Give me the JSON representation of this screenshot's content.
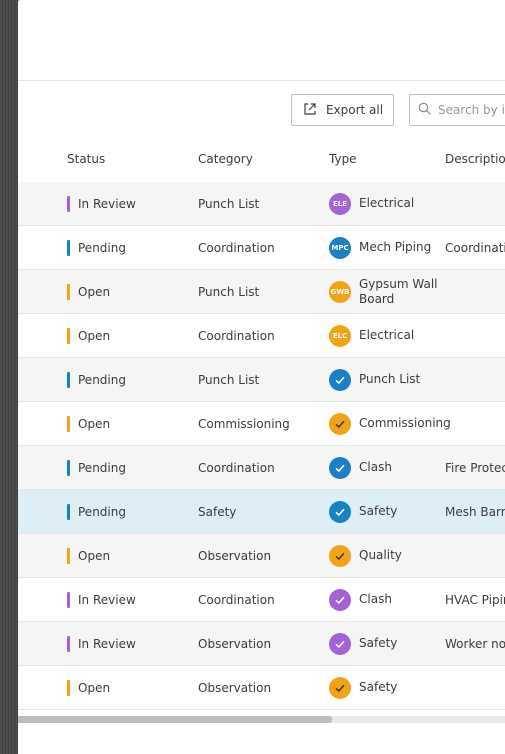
{
  "colors": {
    "in_review": "#a463d7",
    "pending": "#1b80c4",
    "open": "#f2a31a",
    "selected_row": "#ddeef6"
  },
  "toolbar": {
    "export_label": "Export all",
    "export_icon": "export-icon",
    "search_placeholder": "Search by issue",
    "search_icon": "search-icon"
  },
  "table": {
    "headers": {
      "status": "Status",
      "category": "Category",
      "type": "Type",
      "description": "Description"
    },
    "rows": [
      {
        "status": "In Review",
        "status_key": "in_review",
        "category": "Punch List",
        "type": "Electrical",
        "badge": "ELE",
        "badge_color": "#a463d7",
        "description": ""
      },
      {
        "status": "Pending",
        "status_key": "pending",
        "category": "Coordination",
        "type": "Mech Piping",
        "badge": "MPC",
        "badge_color": "#1b80c4",
        "description": "Coordination"
      },
      {
        "status": "Open",
        "status_key": "open",
        "category": "Punch List",
        "type": "Gypsum Wall Board",
        "badge": "GWB",
        "badge_color": "#f2a31a",
        "description": ""
      },
      {
        "status": "Open",
        "status_key": "open",
        "category": "Coordination",
        "type": "Electrical",
        "badge": "ELC",
        "badge_color": "#f2a31a",
        "description": ""
      },
      {
        "status": "Pending",
        "status_key": "pending",
        "category": "Punch List",
        "type": "Punch List",
        "badge": "check-icon",
        "badge_color": "#1b80c4",
        "description": ""
      },
      {
        "status": "Open",
        "status_key": "open",
        "category": "Commissioning",
        "type": "Commissioning",
        "badge": "check-icon",
        "badge_color": "#f2a31a",
        "description": ""
      },
      {
        "status": "Pending",
        "status_key": "pending",
        "category": "Coordination",
        "type": "Clash",
        "badge": "check-icon",
        "badge_color": "#1b80c4",
        "description": "Fire Protection"
      },
      {
        "status": "Pending",
        "status_key": "pending",
        "category": "Safety",
        "type": "Safety",
        "badge": "check-icon",
        "badge_color": "#1b80c4",
        "description": "Mesh Barrier",
        "selected": true
      },
      {
        "status": "Open",
        "status_key": "open",
        "category": "Observation",
        "type": "Quality",
        "badge": "check-icon",
        "badge_color": "#f2a31a",
        "description": ""
      },
      {
        "status": "In Review",
        "status_key": "in_review",
        "category": "Coordination",
        "type": "Clash",
        "badge": "check-icon",
        "badge_color": "#a463d7",
        "description": "HVAC Piping"
      },
      {
        "status": "In Review",
        "status_key": "in_review",
        "category": "Observation",
        "type": "Safety",
        "badge": "check-icon",
        "badge_color": "#a463d7",
        "description": "Worker no"
      },
      {
        "status": "Open",
        "status_key": "open",
        "category": "Observation",
        "type": "Safety",
        "badge": "check-icon",
        "badge_color": "#f2a31a",
        "description": ""
      }
    ]
  }
}
